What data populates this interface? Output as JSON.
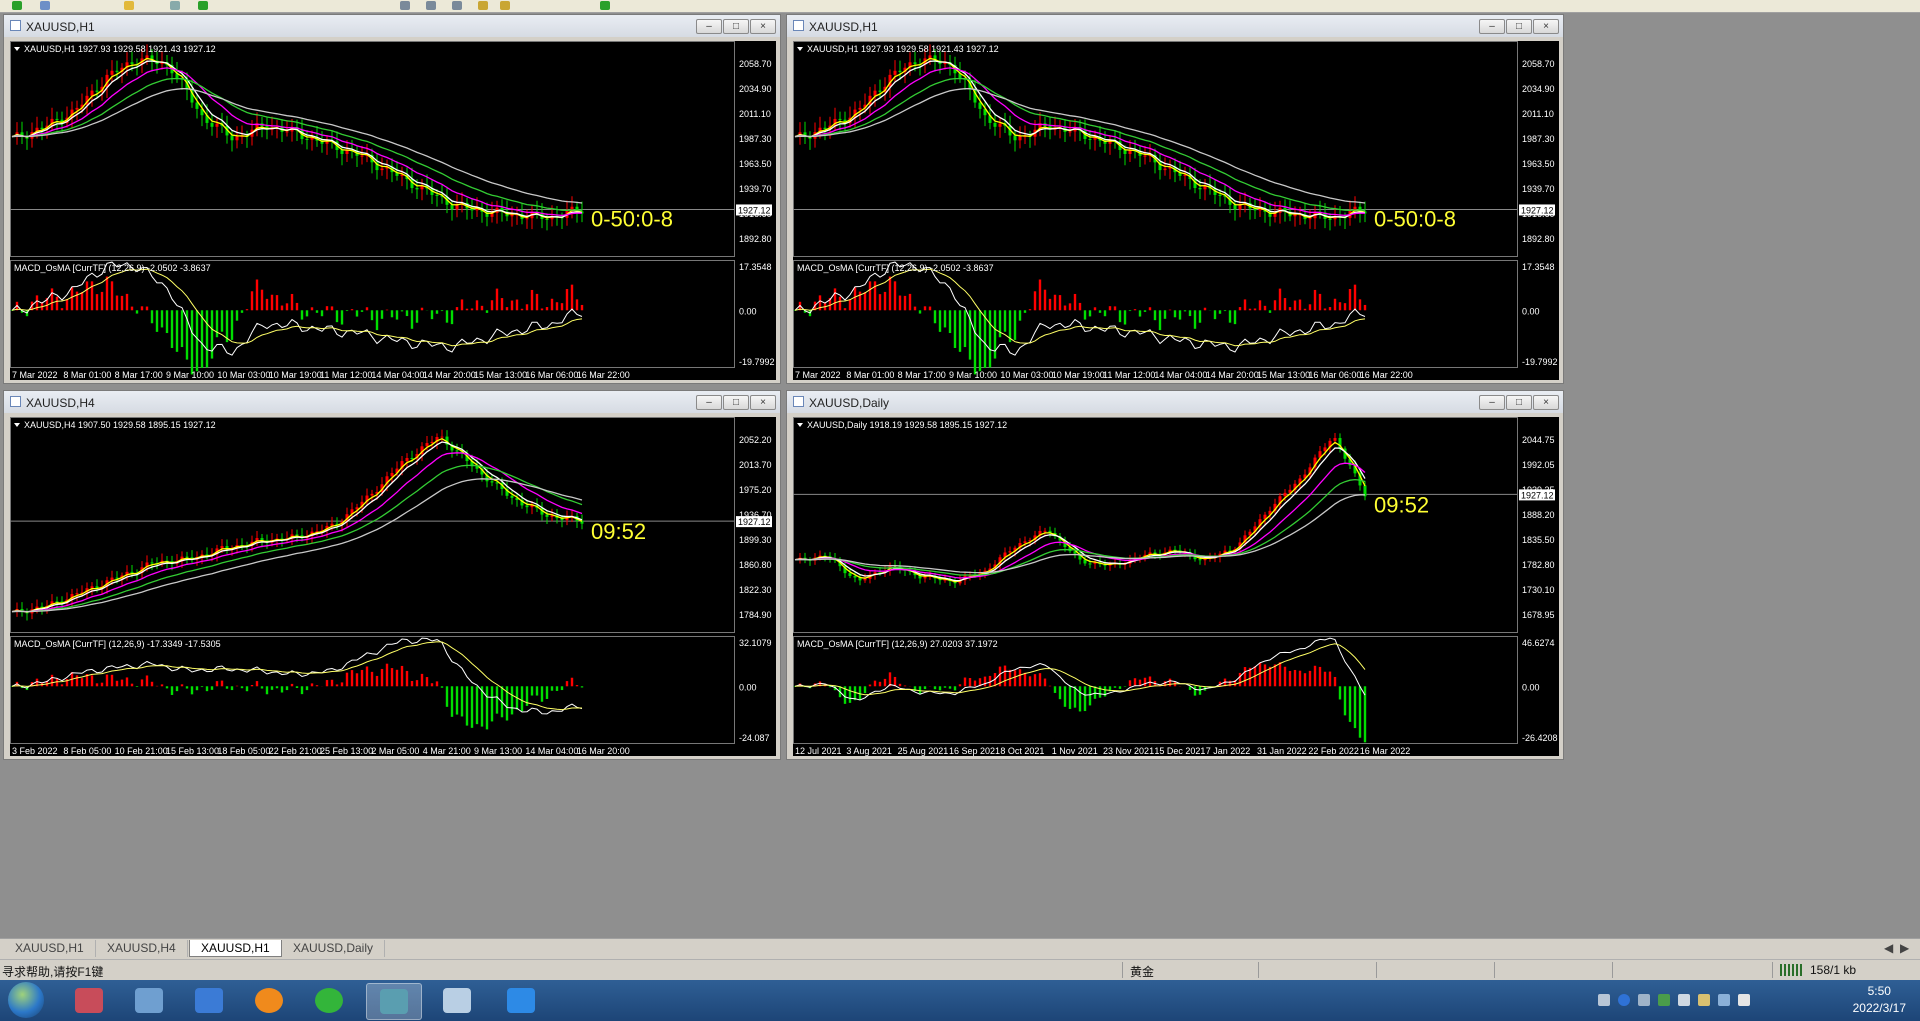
{
  "colors": {
    "bull": "#ff0000",
    "bear": "#00dd00",
    "ma_fast": "#ffff00",
    "ma_mid": "#ffffff",
    "ma_magenta": "#ff00ff",
    "ma_green": "#33cc33",
    "ma_slow": "#c8c8c8",
    "grid": "#888888",
    "text": "#ffffff",
    "timer": "#ffff33"
  },
  "windows": [
    {
      "key": "w1",
      "title": "XAUUSD,H1",
      "symbol_line": "XAUUSD,H1  1927.93 1929.58 1921.43 1927.12",
      "price_labels": [
        "2058.70",
        "2034.90",
        "2011.10",
        "1987.30",
        "1963.50",
        "1939.70",
        "1916.60",
        "1892.80"
      ],
      "current_price": "1927.12",
      "timer": "0-50:0-8",
      "osc_label": "MACD_OsMA [CurrTF] (12,26,9) -2.0502 -3.8637",
      "osc_labels": [
        "17.3548",
        "0.00",
        "-19.7992"
      ],
      "dates": [
        "7 Mar 2022",
        "8 Mar 01:00",
        "8 Mar 17:00",
        "9 Mar 10:00",
        "10 Mar 03:00",
        "10 Mar 19:00",
        "11 Mar 12:00",
        "14 Mar 04:00",
        "14 Mar 20:00",
        "15 Mar 13:00",
        "16 Mar 06:00",
        "16 Mar 22:00"
      ]
    },
    {
      "key": "w2",
      "title": "XAUUSD,H1",
      "symbol_line": "XAUUSD,H1  1927.93 1929.58 1921.43 1927.12",
      "price_labels": [
        "2058.70",
        "2034.90",
        "2011.10",
        "1987.30",
        "1963.50",
        "1939.70",
        "1916.60",
        "1892.80"
      ],
      "current_price": "1927.12",
      "timer": "0-50:0-8",
      "osc_label": "MACD_OsMA [CurrTF] (12,26,9) -2.0502 -3.8637",
      "osc_labels": [
        "17.3548",
        "0.00",
        "-19.7992"
      ],
      "dates": [
        "7 Mar 2022",
        "8 Mar 01:00",
        "8 Mar 17:00",
        "9 Mar 10:00",
        "10 Mar 03:00",
        "10 Mar 19:00",
        "11 Mar 12:00",
        "14 Mar 04:00",
        "14 Mar 20:00",
        "15 Mar 13:00",
        "16 Mar 06:00",
        "16 Mar 22:00"
      ]
    },
    {
      "key": "w3",
      "title": "XAUUSD,H4",
      "symbol_line": "XAUUSD,H4  1907.50 1929.58 1895.15 1927.12",
      "price_labels": [
        "2052.20",
        "2013.70",
        "1975.20",
        "1936.70",
        "1899.30",
        "1860.80",
        "1822.30",
        "1784.90"
      ],
      "current_price": "1927.12",
      "timer": "09:52",
      "osc_label": "MACD_OsMA [CurrTF] (12,26,9) -17.3349 -17.5305",
      "osc_labels": [
        "32.1079",
        "0.00",
        "-24.087"
      ],
      "dates": [
        "3 Feb 2022",
        "8 Feb 05:00",
        "10 Feb 21:00",
        "15 Feb 13:00",
        "18 Feb 05:00",
        "22 Feb 21:00",
        "25 Feb 13:00",
        "2 Mar 05:00",
        "4 Mar 21:00",
        "9 Mar 13:00",
        "14 Mar 04:00",
        "16 Mar 20:00"
      ]
    },
    {
      "key": "w4",
      "title": "XAUUSD,Daily",
      "symbol_line": "XAUUSD,Daily  1918.19 1929.58 1895.15 1927.12",
      "price_labels": [
        "2044.75",
        "1992.05",
        "1939.35",
        "1888.20",
        "1835.50",
        "1782.80",
        "1730.10",
        "1678.95"
      ],
      "current_price": "1927.12",
      "timer": "09:52",
      "osc_label": "MACD_OsMA [CurrTF] (12,26,9) 27.0203 37.1972",
      "osc_labels": [
        "46.6274",
        "0.00",
        "-26.4208"
      ],
      "dates": [
        "12 Jul 2021",
        "3 Aug 2021",
        "25 Aug 2021",
        "16 Sep 2021",
        "8 Oct 2021",
        "1 Nov 2021",
        "23 Nov 2021",
        "15 Dec 2021",
        "7 Jan 2022",
        "31 Jan 2022",
        "22 Feb 2022",
        "16 Mar 2022"
      ]
    }
  ],
  "tabs": [
    "XAUUSD,H1",
    "XAUUSD,H4",
    "XAUUSD,H1",
    "XAUUSD,Daily"
  ],
  "active_tab": 2,
  "status": {
    "help": "寻求帮助,请按F1键",
    "symbol": "黄金",
    "traffic": "158/1 kb"
  },
  "clock": {
    "time": "5:50",
    "date": "2022/3/17"
  },
  "chart_data": [
    {
      "type": "line",
      "title": "XAUUSD,H1",
      "ylim": [
        1892.8,
        2070
      ],
      "series": [
        {
          "name": "XAUUSD,H1",
          "values": [
            1990,
            2000,
            2015,
            2045,
            2062,
            2055,
            2010,
            1990,
            2002,
            1995,
            1985,
            1975,
            1960,
            1945,
            1930,
            1925,
            1922,
            1920,
            1927
          ]
        }
      ]
    },
    {
      "type": "line",
      "title": "XAUUSD,H1",
      "ylim": [
        1892.8,
        2070
      ],
      "series": [
        {
          "name": "XAUUSD,H1",
          "values": [
            1990,
            2000,
            2015,
            2045,
            2062,
            2055,
            2010,
            1990,
            2002,
            1995,
            1985,
            1975,
            1960,
            1945,
            1930,
            1925,
            1922,
            1920,
            1927
          ]
        }
      ]
    },
    {
      "type": "line",
      "title": "XAUUSD,H4",
      "ylim": [
        1784.9,
        2060
      ],
      "series": [
        {
          "name": "XAUUSD,H4",
          "values": [
            1800,
            1810,
            1830,
            1850,
            1870,
            1875,
            1890,
            1900,
            1905,
            1920,
            1960,
            2010,
            2045,
            2000,
            1960,
            1935,
            1927
          ]
        }
      ]
    },
    {
      "type": "line",
      "title": "XAUUSD,Daily",
      "ylim": [
        1678.95,
        2060
      ],
      "series": [
        {
          "name": "XAUUSD,Daily",
          "values": [
            1800,
            1810,
            1760,
            1790,
            1770,
            1760,
            1780,
            1830,
            1860,
            1800,
            1790,
            1810,
            1820,
            1800,
            1830,
            1900,
            1960,
            2040,
            1927
          ]
        }
      ]
    }
  ]
}
